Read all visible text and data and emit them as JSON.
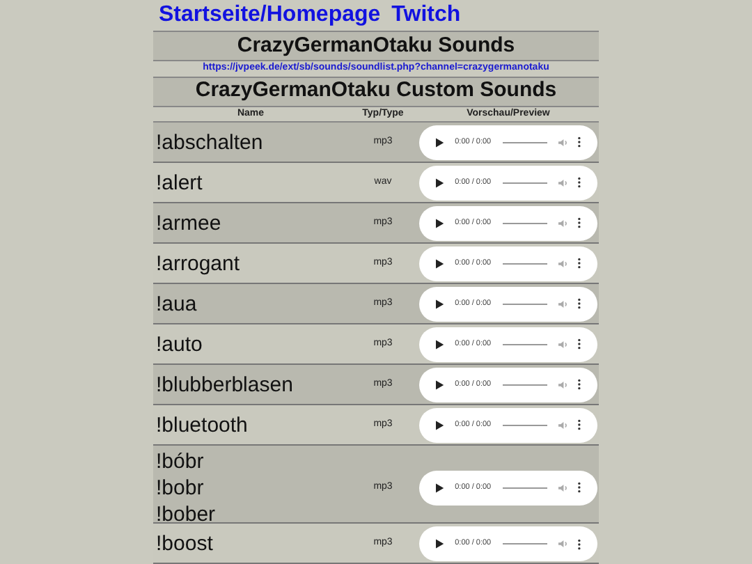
{
  "nav_links": [
    "Startseite/Homepage",
    "Twitch"
  ],
  "title": "CrazyGermanOtaku Sounds",
  "url": "https://jvpeek.de/ext/sb/sounds/soundlist.php?channel=crazygermanotaku",
  "subtitle": "CrazyGermanOtaku Custom Sounds",
  "table": {
    "columns": [
      "Name",
      "Typ/Type",
      "Vorschau/Preview"
    ],
    "rows": [
      {
        "names": [
          "!abschalten"
        ],
        "type": "mp3",
        "time": "0:00 / 0:00"
      },
      {
        "names": [
          "!alert"
        ],
        "type": "wav",
        "time": "0:00 / 0:00"
      },
      {
        "names": [
          "!armee"
        ],
        "type": "mp3",
        "time": "0:00 / 0:00"
      },
      {
        "names": [
          "!arrogant"
        ],
        "type": "mp3",
        "time": "0:00 / 0:00"
      },
      {
        "names": [
          "!aua"
        ],
        "type": "mp3",
        "time": "0:00 / 0:00"
      },
      {
        "names": [
          "!auto"
        ],
        "type": "mp3",
        "time": "0:00 / 0:00"
      },
      {
        "names": [
          "!blubberblasen"
        ],
        "type": "mp3",
        "time": "0:00 / 0:00"
      },
      {
        "names": [
          "!bluetooth"
        ],
        "type": "mp3",
        "time": "0:00 / 0:00"
      },
      {
        "names": [
          "!bóbr",
          "!bobr",
          "!bober"
        ],
        "type": "mp3",
        "time": "0:00 / 0:00"
      },
      {
        "names": [
          "!boost"
        ],
        "type": "mp3",
        "time": "0:00 / 0:00"
      }
    ]
  }
}
